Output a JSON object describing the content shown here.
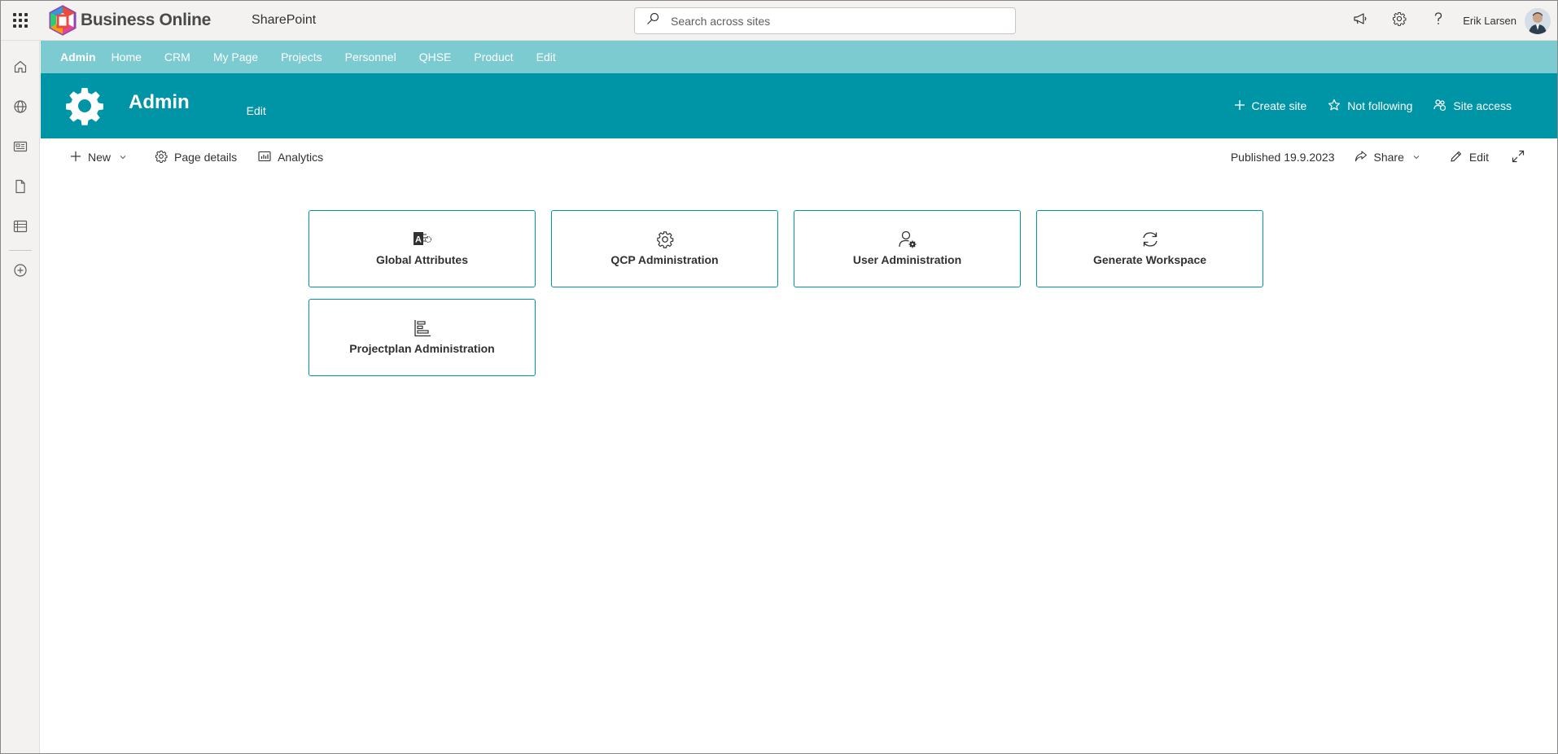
{
  "suite": {
    "brand_name": "Business Online",
    "app_name": "SharePoint",
    "search_placeholder": "Search across sites",
    "user_name": "Erik Larsen"
  },
  "hub_nav": {
    "items": [
      {
        "label": "Admin"
      },
      {
        "label": "Home"
      },
      {
        "label": "CRM"
      },
      {
        "label": "My Page"
      },
      {
        "label": "Projects"
      },
      {
        "label": "Personnel"
      },
      {
        "label": "QHSE"
      },
      {
        "label": "Product"
      },
      {
        "label": "Edit"
      }
    ]
  },
  "site_header": {
    "title": "Admin",
    "edit_label": "Edit",
    "actions": {
      "create_site": "Create site",
      "not_following": "Not following",
      "site_access": "Site access"
    }
  },
  "command_bar": {
    "new_label": "New",
    "page_details_label": "Page details",
    "analytics_label": "Analytics",
    "published": "Published 19.9.2023",
    "share_label": "Share",
    "edit_label": "Edit"
  },
  "tiles": [
    {
      "label": "Global Attributes",
      "icon": "access-icon"
    },
    {
      "label": "QCP Administration",
      "icon": "gear-icon"
    },
    {
      "label": "User Administration",
      "icon": "user-settings-icon"
    },
    {
      "label": "Generate Workspace",
      "icon": "sync-icon"
    },
    {
      "label": "Projectplan Administration",
      "icon": "project-plan-icon"
    }
  ],
  "colors": {
    "hub_nav_bg": "#7ccbd1",
    "site_header_bg": "#0095a6",
    "tile_border": "#0095a6"
  }
}
